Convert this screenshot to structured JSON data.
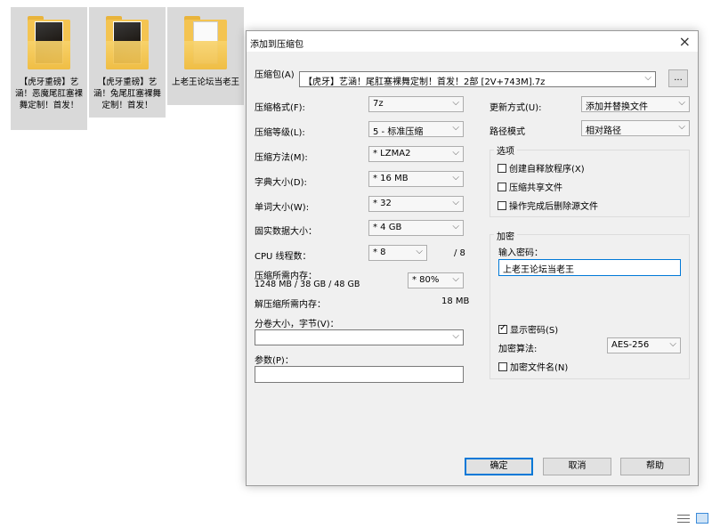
{
  "desktop": {
    "folders": [
      {
        "label": "【虎牙重磅】艺涵！恶魔尾肛塞裸舞定制！首发！",
        "thumb": "photo"
      },
      {
        "label": "【虎牙重磅】艺涵！兔尾肛塞裸舞定制！首发！",
        "thumb": "photo"
      },
      {
        "label": "上老王论坛当老王",
        "thumb": "document"
      }
    ]
  },
  "dialog": {
    "title": "添加到压缩包",
    "close_icon": "×",
    "archive_label": "压缩包(A)",
    "archive_value": "【虎牙】艺涵！尾肛塞裸舞定制！首发！2部 [2V+743M].7z",
    "browse_label": "...",
    "format_label": "压缩格式(F):",
    "format_value": "7z",
    "level_label": "压缩等级(L):",
    "level_value": "5 - 标准压缩",
    "method_label": "压缩方法(M):",
    "method_value": "* LZMA2",
    "dict_label": "字典大小(D):",
    "dict_value": "* 16 MB",
    "word_label": "单词大小(W):",
    "word_value": "* 32",
    "solid_label": "固实数据大小：",
    "solid_value": "* 4 GB",
    "cpu_label": "CPU 线程数：",
    "cpu_value": "* 8",
    "cpu_max": "/ 8",
    "mem_label": "压缩所需内存：",
    "mem_value": "1248 MB / 38 GB / 48 GB",
    "mem_percent": "* 80%",
    "decomp_label": "解压缩所需内存：",
    "decomp_value": "18 MB",
    "split_label": "分卷大小，字节(V)：",
    "split_value": "",
    "params_label": "参数(P)：",
    "params_value": "",
    "update_label": "更新方式(U):",
    "update_value": "添加并替换文件",
    "path_label": "路径模式",
    "path_value": "相对路径",
    "options_title": "选项",
    "opt_sfx": "创建自释放程序(X)",
    "opt_shared": "压缩共享文件",
    "opt_delete": "操作完成后删除源文件",
    "enc_title": "加密",
    "enc_password_label": "输入密码：",
    "enc_password_value": "上老王论坛当老王",
    "enc_show_password": "显示密码(S)",
    "enc_method_label": "加密算法:",
    "enc_method_value": "AES-256",
    "enc_filenames": "加密文件名(N)",
    "ok_label": "确定",
    "cancel_label": "取消",
    "help_label": "帮助",
    "chevron": "⌵"
  },
  "colors": {
    "accent": "#0078d7",
    "dialog_bg": "#f0f0f0",
    "folder": "#f4c451"
  }
}
